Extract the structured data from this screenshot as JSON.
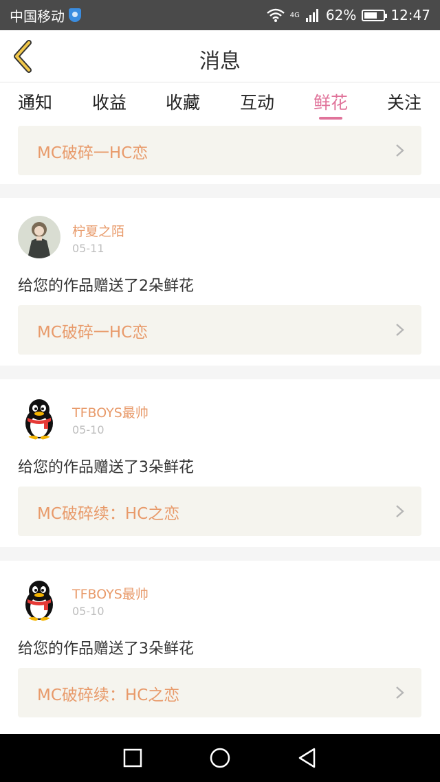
{
  "status_bar": {
    "carrier": "中国移动",
    "network": "4G",
    "battery": "62%",
    "time": "12:47"
  },
  "header": {
    "title": "消息"
  },
  "tabs": [
    {
      "label": "通知",
      "active": false
    },
    {
      "label": "收益",
      "active": false
    },
    {
      "label": "收藏",
      "active": false
    },
    {
      "label": "互动",
      "active": false
    },
    {
      "label": "鲜花",
      "active": true
    },
    {
      "label": "关注",
      "active": false
    }
  ],
  "messages": [
    {
      "user": "",
      "date": "",
      "text": "",
      "work": "MC破碎一HC恋",
      "partial": true
    },
    {
      "user": "柠夏之陌",
      "date": "05-11",
      "text": "给您的作品赠送了2朵鲜花",
      "work": "MC破碎一HC恋",
      "avatar": "girl-avatar"
    },
    {
      "user": "TFBOYS最帅",
      "date": "05-10",
      "text": "给您的作品赠送了3朵鲜花",
      "work": "MC破碎续：HC之恋",
      "avatar": "penguin-avatar"
    },
    {
      "user": "TFBOYS最帅",
      "date": "05-10",
      "text": "给您的作品赠送了3朵鲜花",
      "work": "MC破碎续：HC之恋",
      "avatar": "penguin-avatar"
    }
  ],
  "colors": {
    "accent": "#e0739a",
    "username": "#e89a6a",
    "status_bar": "#4a4a4a"
  }
}
